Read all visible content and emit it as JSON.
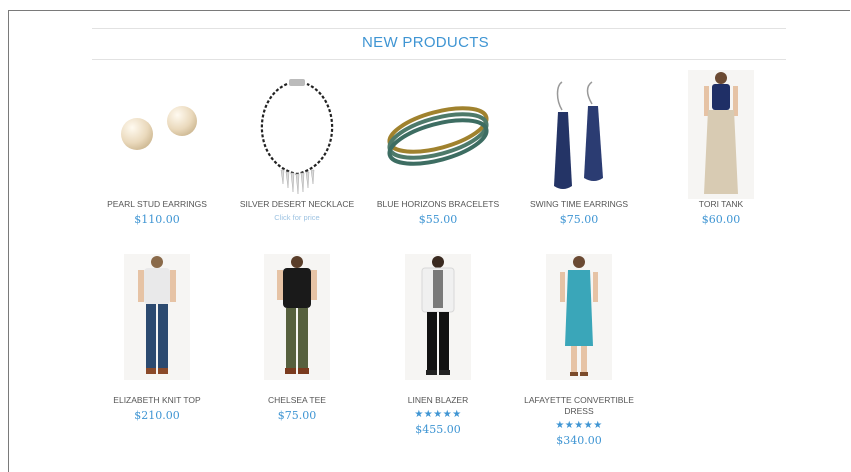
{
  "section": {
    "title": "NEW PRODUCTS"
  },
  "colors": {
    "accent": "#3f95d3",
    "star": "#3f95d3"
  },
  "products": [
    {
      "name": "PEARL STUD EARRINGS",
      "price": "$110.00",
      "image_icon": "pearl-earrings-image"
    },
    {
      "name": "SILVER DESERT NECKLACE",
      "price_note": "Click for price",
      "image_icon": "necklace-image"
    },
    {
      "name": "BLUE HORIZONS BRACELETS",
      "price": "$55.00",
      "image_icon": "bracelets-image"
    },
    {
      "name": "SWING TIME EARRINGS",
      "price": "$75.00",
      "image_icon": "drop-earrings-image"
    },
    {
      "name": "TORI TANK",
      "price": "$60.00",
      "image_icon": "model-image"
    },
    {
      "name": "ELIZABETH KNIT TOP",
      "price": "$210.00",
      "image_icon": "model-image"
    },
    {
      "name": "CHELSEA TEE",
      "price": "$75.00",
      "image_icon": "model-image"
    },
    {
      "name": "LINEN BLAZER",
      "stars": "★★★★★",
      "price": "$455.00",
      "rating": 5,
      "image_icon": "model-image"
    },
    {
      "name": "LAFAYETTE CONVERTIBLE DRESS",
      "stars": "★★★★★",
      "price": "$340.00",
      "rating": 5,
      "image_icon": "model-image"
    }
  ]
}
